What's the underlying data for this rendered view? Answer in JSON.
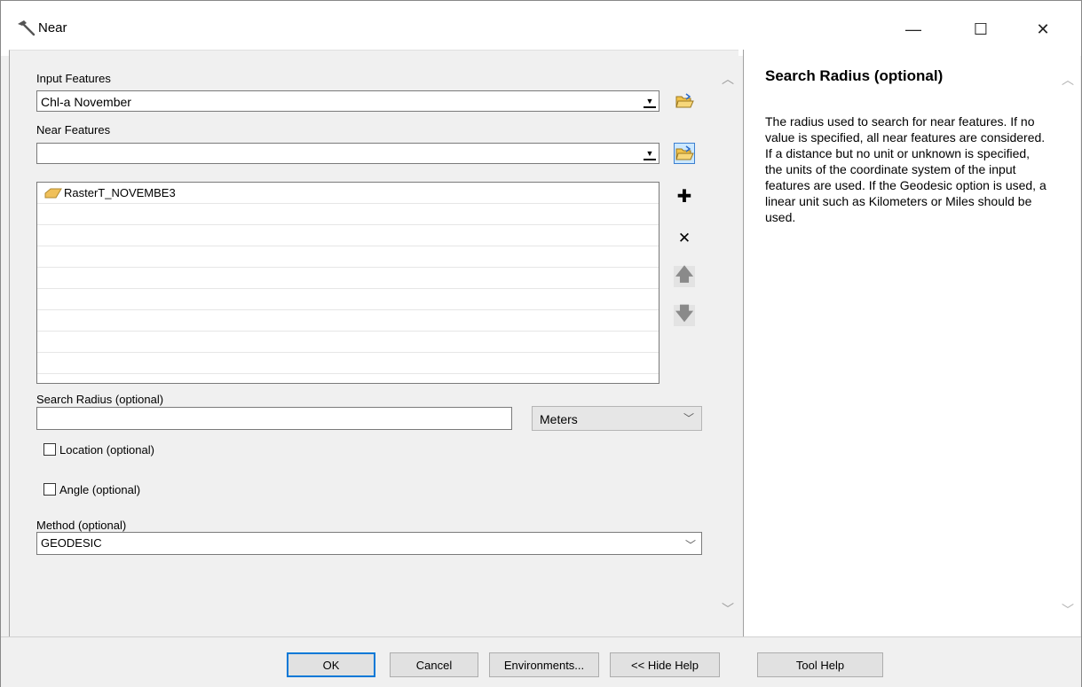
{
  "window": {
    "title": "Near",
    "minimize_glyph": "—",
    "maximize_glyph": "☐",
    "close_glyph": "✕"
  },
  "form": {
    "input_features_label": "Input Features",
    "input_features_value": "Chl-a November",
    "near_features_label": "Near Features",
    "near_features_value": "",
    "near_features_list": [
      "RasterT_NOVEMBE3"
    ],
    "search_radius_label": "Search Radius (optional)",
    "search_radius_value": "",
    "search_radius_unit": "Meters",
    "location_label": "Location (optional)",
    "location_checked": false,
    "angle_label": "Angle (optional)",
    "angle_checked": false,
    "method_label": "Method (optional)",
    "method_value": "GEODESIC"
  },
  "help": {
    "title": "Search Radius (optional)",
    "body": "The radius used to search for near features. If no value is specified, all near features are considered. If a distance but no unit or unknown is specified, the units of the coordinate system of the input features are used. If the Geodesic option is used, a linear unit such as Kilometers or Miles should be used."
  },
  "buttons": {
    "ok": "OK",
    "cancel": "Cancel",
    "environments": "Environments...",
    "hide_help": "<< Hide Help",
    "tool_help": "Tool Help"
  },
  "icons": {
    "title": "hammer-icon",
    "browse": "folder-open-icon",
    "add": "plus-icon",
    "remove": "x-icon",
    "up": "arrow-up-icon",
    "down": "arrow-down-icon",
    "raster": "raster-layer-icon"
  },
  "colors": {
    "accent": "#0078d7",
    "folder": "#f2c34a"
  }
}
